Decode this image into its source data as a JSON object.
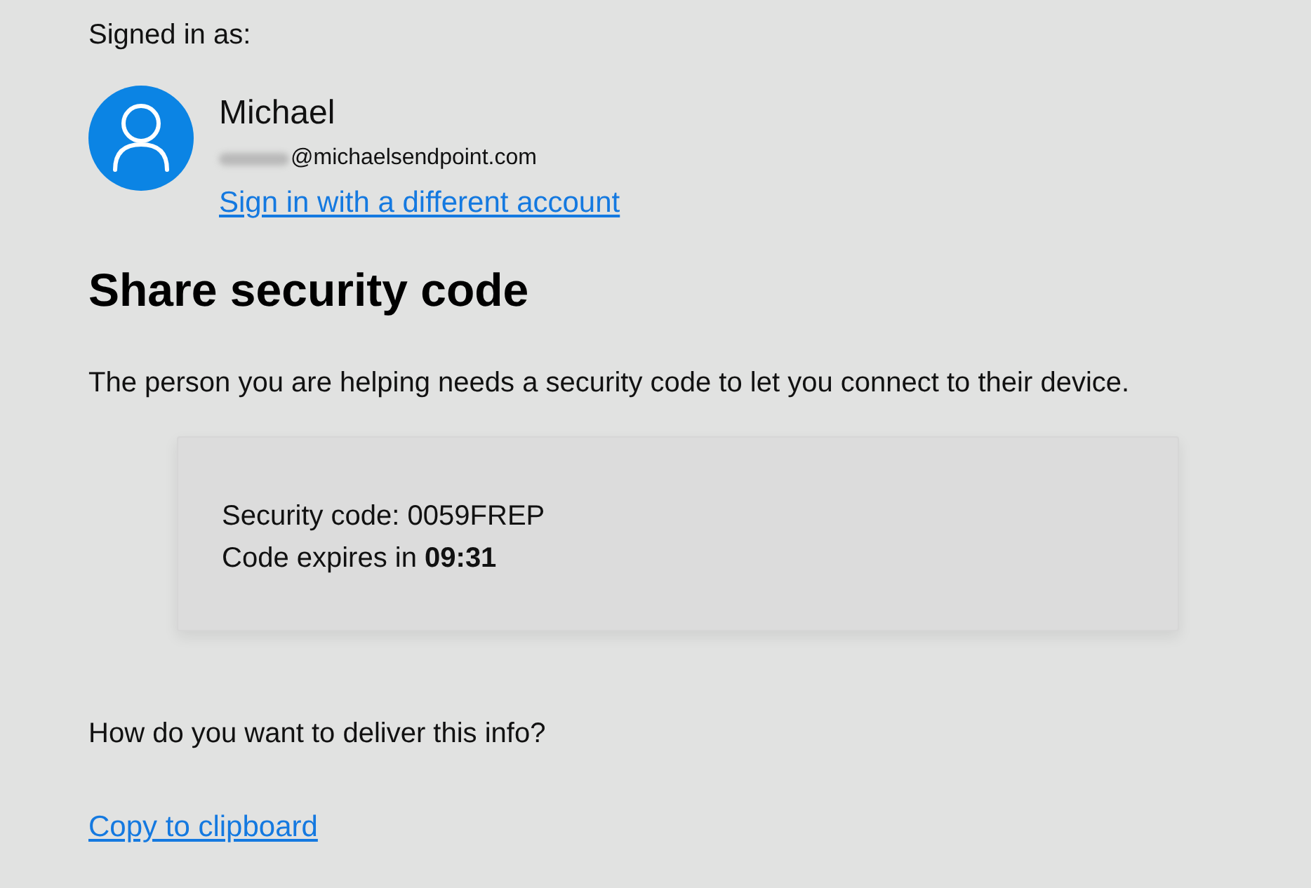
{
  "account": {
    "label": "Signed in as:",
    "name": "Michael",
    "email": {
      "text": "@michaelsendpoint.com",
      "redacted": true
    },
    "switch_link": "Sign in with a different account"
  },
  "heading": "Share security code",
  "description": "The person you are helping needs a security code to let you connect to their device.",
  "code_card": {
    "code_line": "Security code: 0059FREP",
    "expiry_line": "Code expires in **09:31**"
  },
  "delivery": {
    "question": "How do you want to deliver this info?",
    "links": [
      "Copy to clipboard"
    ]
  }
}
